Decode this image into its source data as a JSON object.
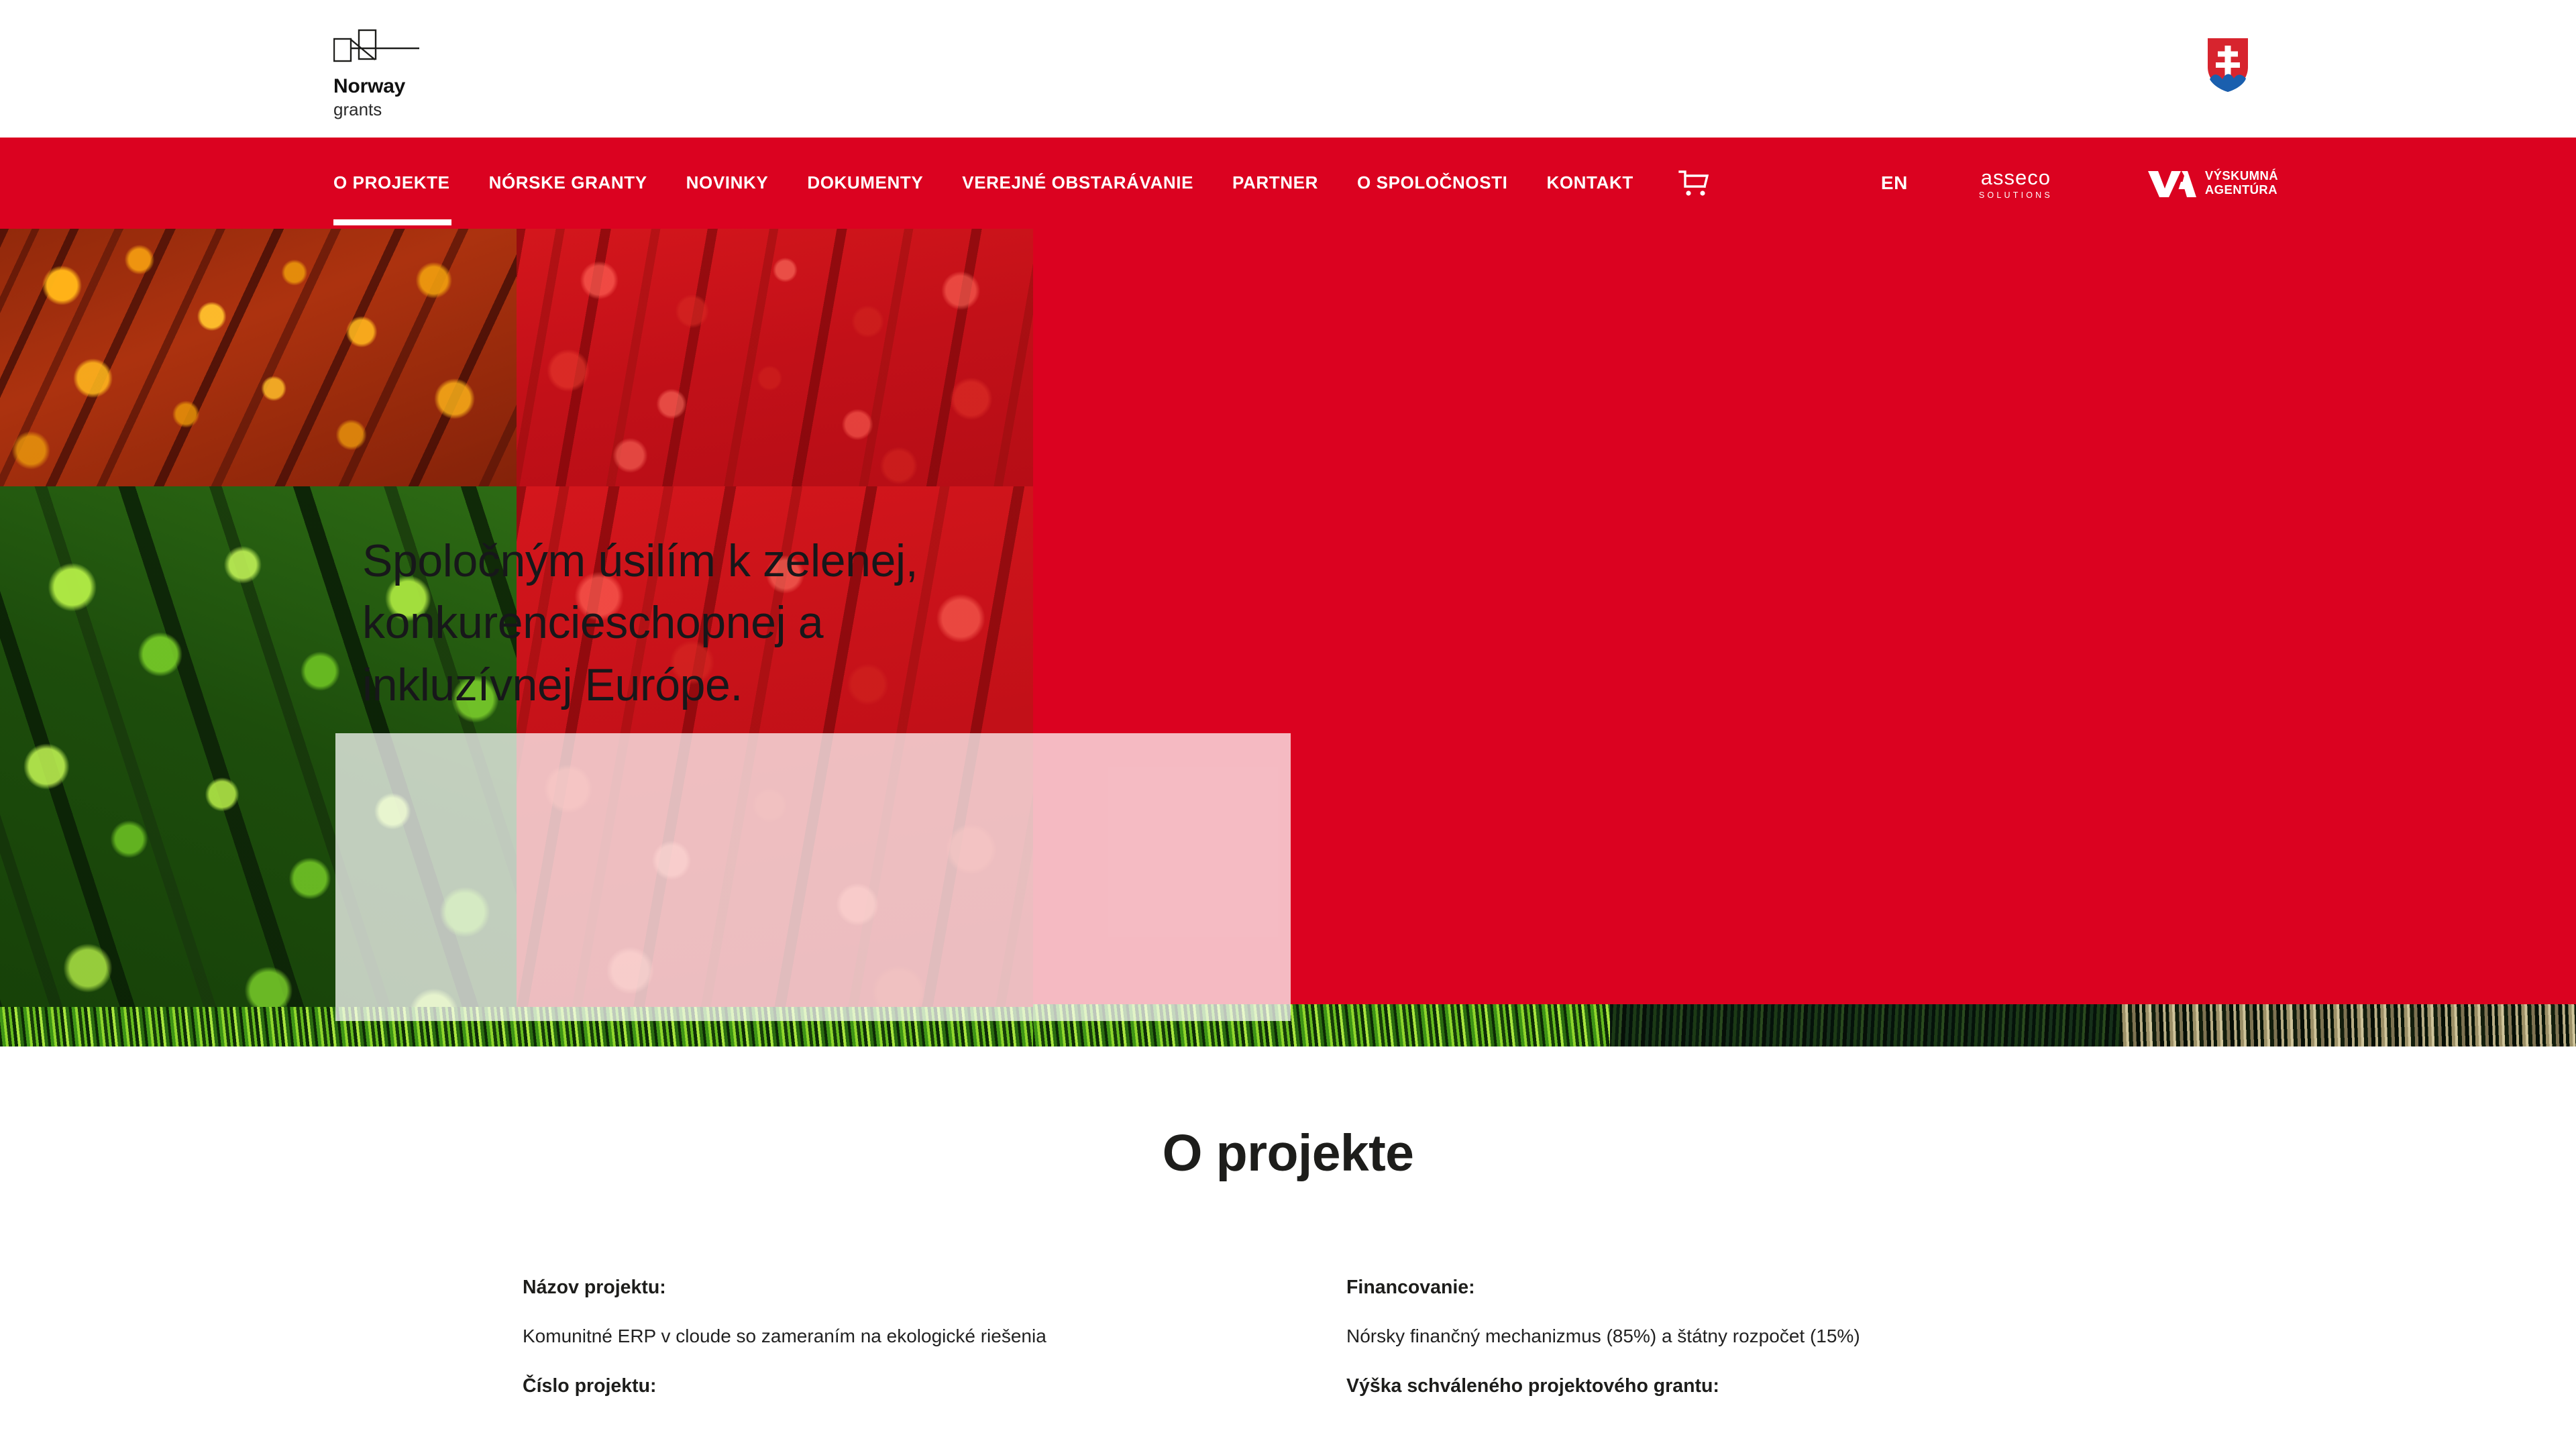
{
  "brand": {
    "logo_word": "Norway",
    "logo_sub": "grants",
    "coat_of_arms_alt": "Slovak coat of arms"
  },
  "colors": {
    "red": "#DB0220",
    "white": "#FFFFFF",
    "text_dark": "#1D1D1B"
  },
  "nav": {
    "items": [
      {
        "label": "O PROJEKTE",
        "active": true
      },
      {
        "label": "NÓRSKE GRANTY",
        "active": false
      },
      {
        "label": "NOVINKY",
        "active": false
      },
      {
        "label": "DOKUMENTY",
        "active": false
      },
      {
        "label": "VEREJNÉ OBSTARÁVANIE",
        "active": false
      },
      {
        "label": "PARTNER",
        "active": false
      },
      {
        "label": "O SPOLOČNOSTI",
        "active": false
      },
      {
        "label": "KONTAKT",
        "active": false
      }
    ],
    "cart_icon": "shopping-cart-icon",
    "language": "EN",
    "asseco": {
      "name": "asseco",
      "tagline": "SOLUTIONS"
    },
    "agency": {
      "line1": "VÝSKUMNÁ",
      "line2": "AGENTÚRA"
    }
  },
  "hero": {
    "headline_line1": "Spoločným úsilím k zelenej,",
    "headline_line2": "konkurencieschopnej a",
    "headline_line3": "inkluzívnej Európe."
  },
  "main": {
    "section_title": "O projekte",
    "left": {
      "field1_label": "Názov projektu:",
      "field1_value": "Komunitné ERP v cloude so zameraním na ekologické riešenia",
      "field2_label": "Číslo projektu:"
    },
    "right": {
      "field1_label": "Financovanie:",
      "field1_value": "Nórsky finančný mechanizmus (85%) a štátny rozpočet (15%)",
      "field2_label": "Výška schváleného projektového grantu:"
    }
  }
}
